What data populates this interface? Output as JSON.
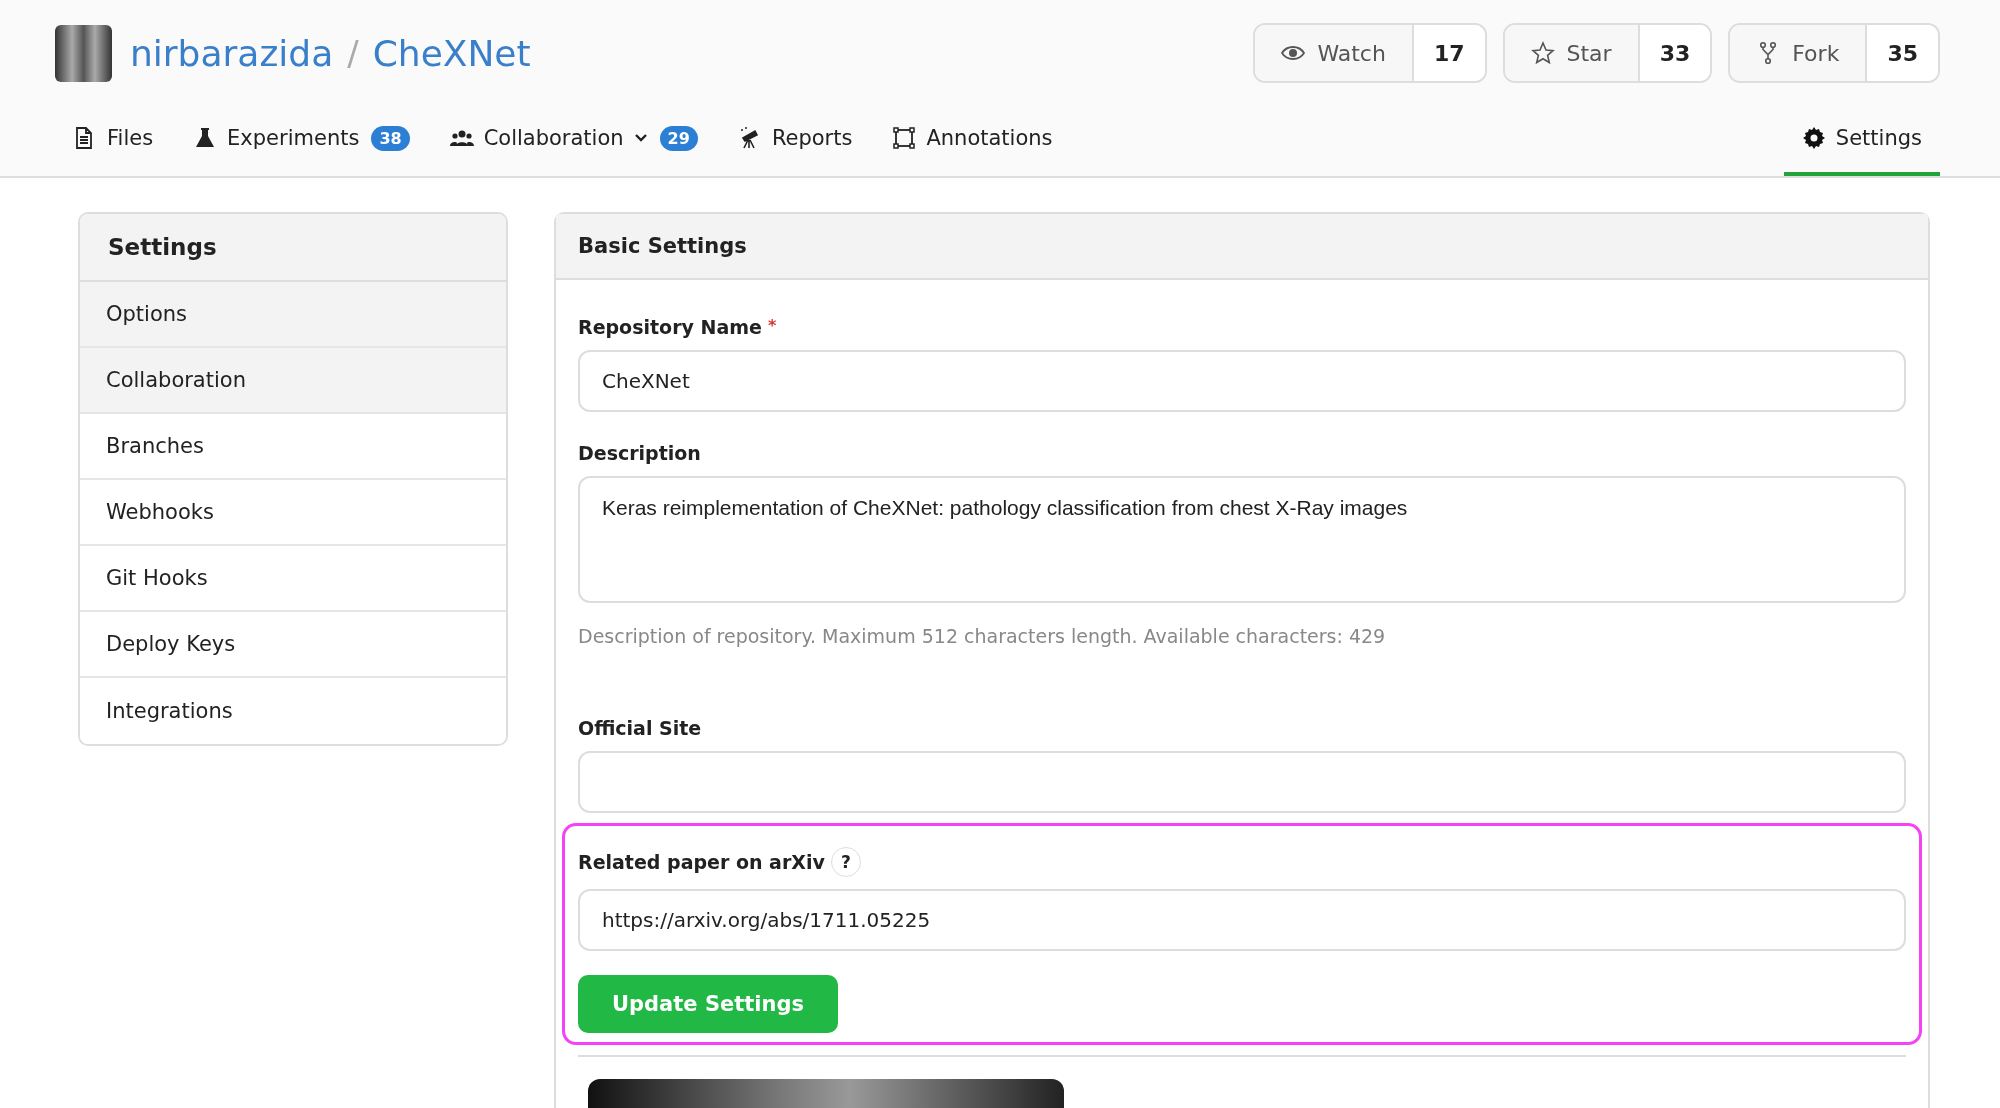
{
  "repo": {
    "owner": "nirbarazida",
    "separator": "/",
    "name": "CheXNet"
  },
  "actions": [
    {
      "kind": "watch",
      "label": "Watch",
      "count": "17"
    },
    {
      "kind": "star",
      "label": "Star",
      "count": "33"
    },
    {
      "kind": "fork",
      "label": "Fork",
      "count": "35"
    }
  ],
  "tabs": [
    {
      "kind": "files",
      "label": "Files",
      "selected": false
    },
    {
      "kind": "experiments",
      "label": "Experiments",
      "badge": "38",
      "selected": false
    },
    {
      "kind": "collaboration",
      "label": "Collaboration",
      "dropdown": true,
      "badge": "29",
      "selected": false
    },
    {
      "kind": "reports",
      "label": "Reports",
      "selected": false
    },
    {
      "kind": "annotations",
      "label": "Annotations",
      "selected": false
    },
    {
      "kind": "settings",
      "label": "Settings",
      "selected": true
    }
  ],
  "sidebar": {
    "title": "Settings",
    "items": [
      {
        "label": "Options",
        "selected": true
      },
      {
        "label": "Collaboration",
        "selected": true
      },
      {
        "label": "Branches",
        "selected": false
      },
      {
        "label": "Webhooks",
        "selected": false
      },
      {
        "label": "Git Hooks",
        "selected": false
      },
      {
        "label": "Deploy Keys",
        "selected": false
      },
      {
        "label": "Integrations",
        "selected": false
      }
    ]
  },
  "panel": {
    "title": "Basic Settings",
    "fields": [
      {
        "kind": "input",
        "label": "Repository Name",
        "required_mark": "*",
        "value": "CheXNet"
      },
      {
        "kind": "textarea",
        "label": "Description",
        "value": "Keras reimplementation of CheXNet: pathology classification from chest X-Ray images",
        "hint": "Description of repository. Maximum 512 characters length. Available characters: 429"
      },
      {
        "kind": "input",
        "label": "Official Site"
      },
      {
        "kind": "input",
        "label": "Related paper on arXiv",
        "help": "?",
        "value": "https://arxiv.org/abs/1711.05225",
        "highlighted": true
      }
    ],
    "submit": "Update Settings"
  }
}
